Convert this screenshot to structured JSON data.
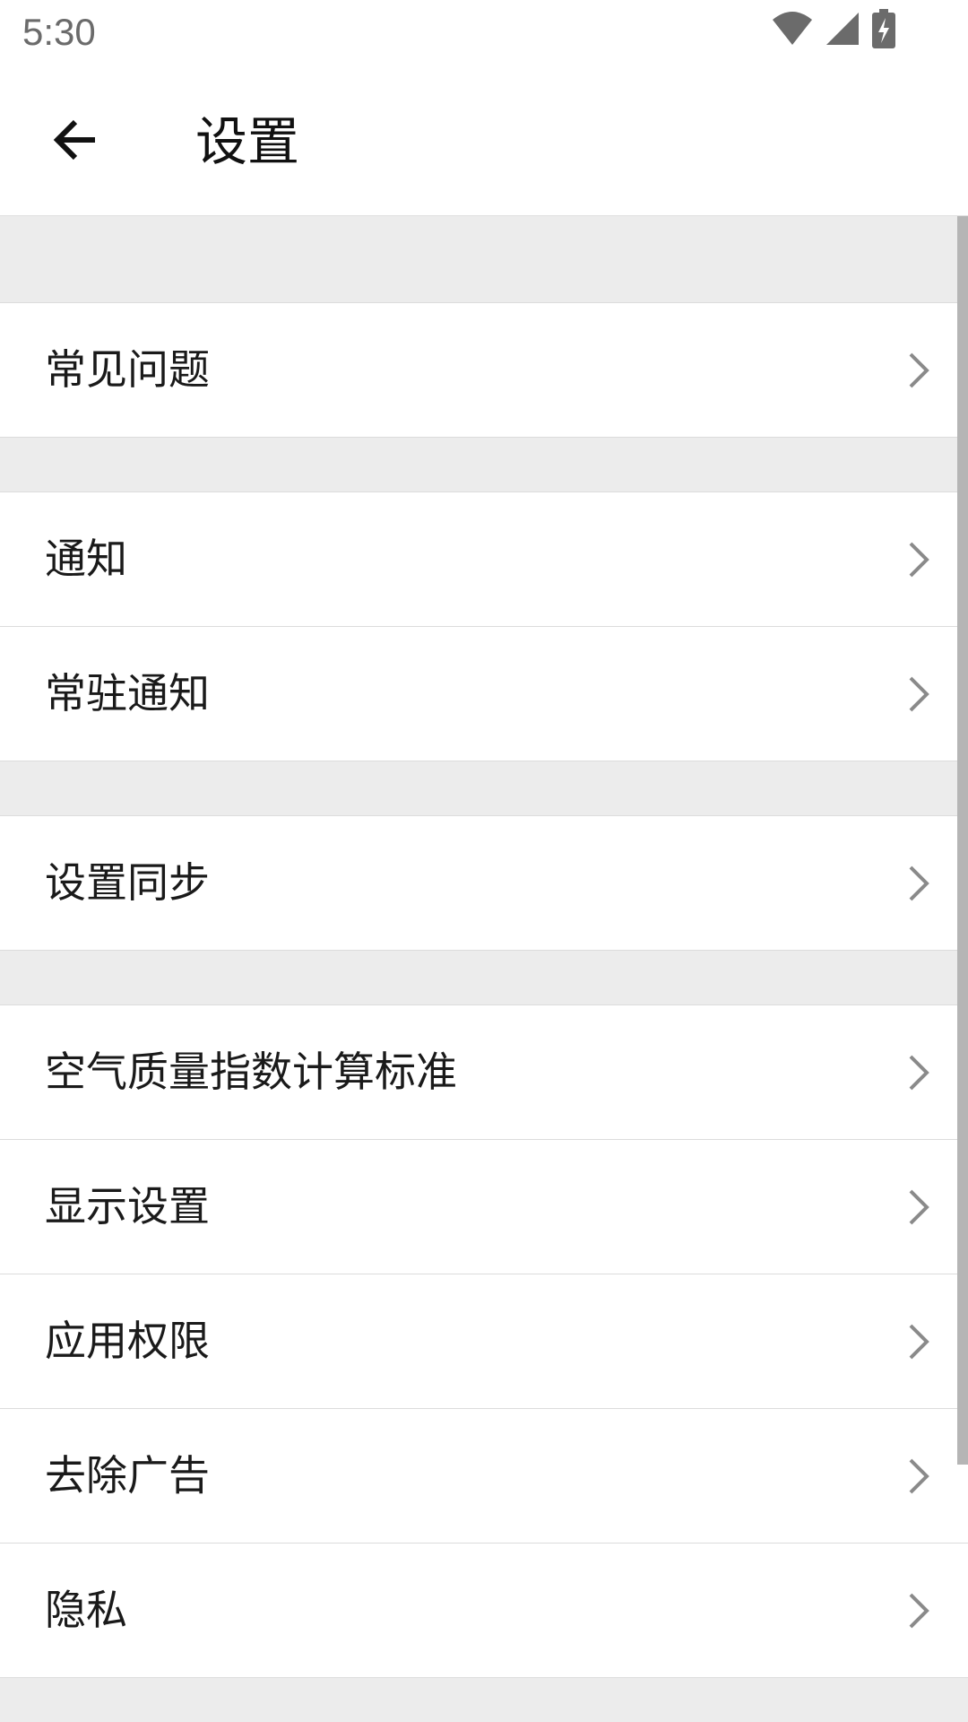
{
  "status_bar": {
    "time": "5:30",
    "icons": [
      "wifi-icon",
      "signal-icon",
      "battery-charging-icon"
    ]
  },
  "toolbar": {
    "back_icon": "arrow-left-icon",
    "title": "设置"
  },
  "sections": [
    {
      "items": [
        {
          "label": "常见问题"
        }
      ]
    },
    {
      "items": [
        {
          "label": "通知"
        },
        {
          "label": "常驻通知"
        }
      ]
    },
    {
      "items": [
        {
          "label": "设置同步"
        }
      ]
    },
    {
      "items": [
        {
          "label": "空气质量指数计算标准"
        },
        {
          "label": "显示设置"
        },
        {
          "label": "应用权限"
        },
        {
          "label": "去除广告"
        },
        {
          "label": "隐私"
        }
      ]
    }
  ],
  "colors": {
    "section_background": "#ececec",
    "divider": "#dcdcdc",
    "chevron": "#8a8a8a",
    "scrollbar": "#b5b5b5"
  }
}
